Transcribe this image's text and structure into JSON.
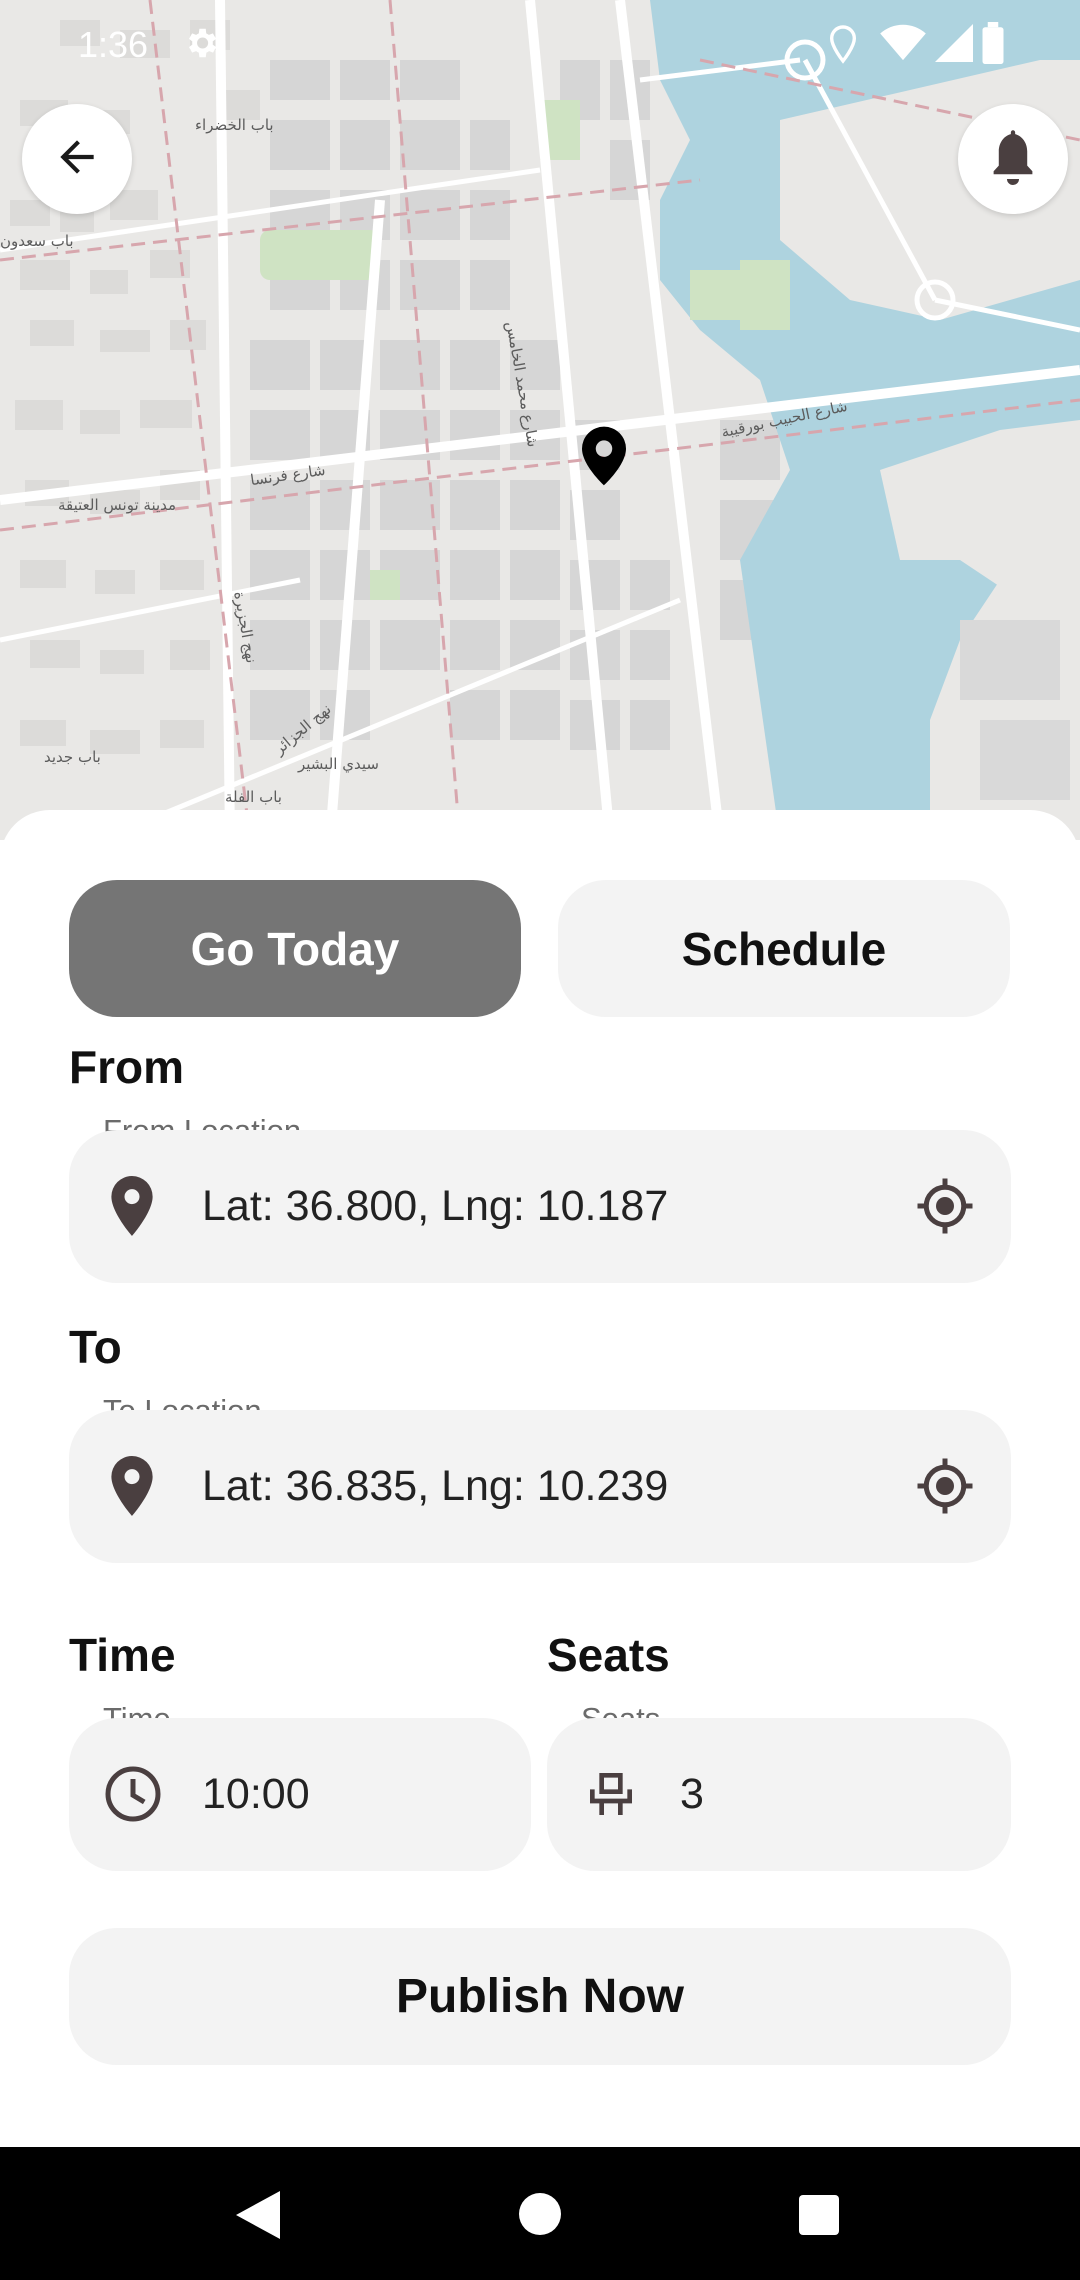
{
  "status_bar": {
    "time": "1:36"
  },
  "map": {
    "labels": [
      "باب الخضراء",
      "باب سعدون",
      "شارع محمد الخامس",
      "شارع الحبيب بورقيبة",
      "شارع فرنسا",
      "مدينة تونس العتيقة",
      "نهج الجزيرة",
      "نهج الجزائر",
      "سيدي البشير",
      "باب جديد",
      "باب الفلة"
    ]
  },
  "mode_tabs": {
    "go_today": "Go Today",
    "schedule": "Schedule"
  },
  "from": {
    "section_title": "From",
    "field_label": "From Location",
    "value": "Lat: 36.800, Lng: 10.187"
  },
  "to": {
    "section_title": "To",
    "field_label": "To Location",
    "value": "Lat: 36.835, Lng: 10.239"
  },
  "time": {
    "section_title": "Time",
    "field_label": "Time",
    "value": "10:00"
  },
  "seats": {
    "section_title": "Seats",
    "field_label": "Seats",
    "value": "3"
  },
  "publish_label": "Publish Now",
  "colors": {
    "active_tab": "#757575",
    "field_bg": "#f3f3f3",
    "water": "#aed3df",
    "park": "#cfe3c3",
    "icon": "#4a3f40"
  }
}
